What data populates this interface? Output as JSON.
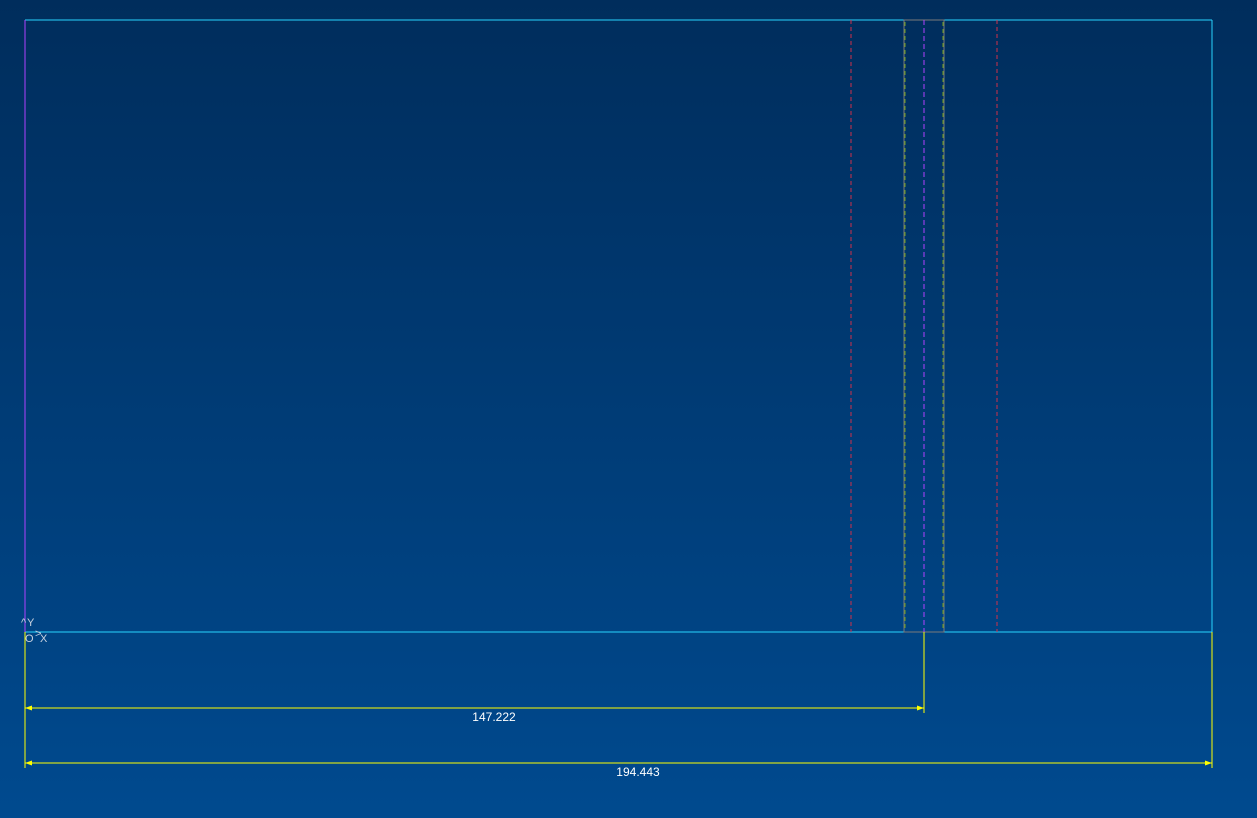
{
  "viewport": {
    "background_top": "#002d5c",
    "background_bottom": "#004a8f"
  },
  "colors": {
    "outline": "#27d4ff",
    "left_edge": "#b040ff",
    "dimension": "#ffff00",
    "hidden_red": "#d0304a",
    "hidden_green": "#6fa020",
    "centerline": "#b040ff",
    "bar_outline": "#7a7a7a"
  },
  "axis_indicator": {
    "origin_label": "O",
    "x_label": "X",
    "y_label": "Y"
  },
  "dimensions": {
    "inner": {
      "value": "147.222"
    },
    "overall": {
      "value": "194.443"
    }
  }
}
